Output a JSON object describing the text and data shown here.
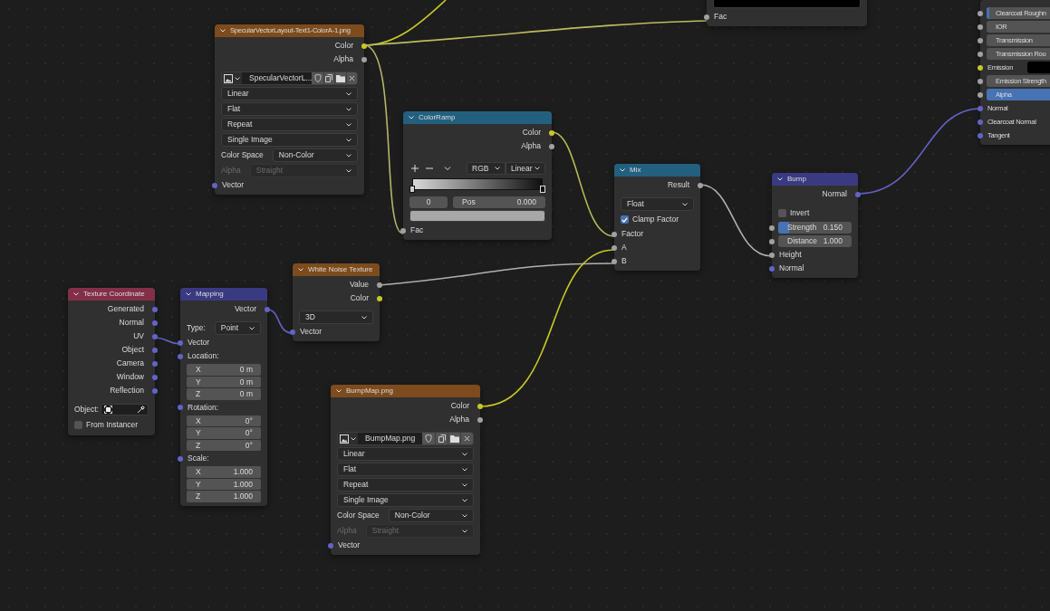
{
  "nodes": [
    {
      "kind": "frame",
      "rows": [
        {
          "kind": "swatch",
          "color": "#000000"
        },
        {
          "kind": "input",
          "label": "Fac",
          "socket": {
            "kind": "float"
          }
        }
      ]
    },
    {
      "kind": "shader",
      "rows": [
        {
          "kind": "slider",
          "label": "Clearcoat Roughn",
          "socket": {
            "kind": "float"
          },
          "level": 0.04
        },
        {
          "kind": "number",
          "label": "IOR",
          "socket": {
            "kind": "float"
          }
        },
        {
          "kind": "number",
          "label": "Transmission",
          "socket": {
            "kind": "float"
          }
        },
        {
          "kind": "number",
          "label": "Transmission Rou",
          "socket": {
            "kind": "float"
          }
        },
        {
          "kind": "color_input",
          "label": "Emission",
          "socket": {
            "kind": "color"
          },
          "color": "#000000"
        },
        {
          "kind": "number",
          "label": "Emission Strength",
          "socket": {
            "kind": "float"
          }
        },
        {
          "kind": "slider",
          "label": "Alpha",
          "socket": {
            "kind": "float"
          },
          "level": 1
        },
        {
          "kind": "input",
          "label": "Normal",
          "socket": {
            "kind": "vector"
          }
        },
        {
          "kind": "input",
          "label": "Clearcoat Normal",
          "socket": {
            "kind": "vector"
          }
        },
        {
          "kind": "input",
          "label": "Tangent",
          "socket": {
            "kind": "vector"
          }
        }
      ]
    },
    {
      "kind": "texture",
      "title": "SpecularVectorLayout-Text1-ColorA-1.png",
      "rows": [
        {
          "kind": "output",
          "label": "Color",
          "socket": {
            "kind": "color"
          }
        },
        {
          "kind": "output",
          "label": "Alpha",
          "socket": {
            "kind": "float"
          }
        },
        {
          "kind": "image",
          "value": "SpecularVectorL..."
        },
        {
          "kind": "select",
          "value": "Linear",
          "disabled": false
        },
        {
          "kind": "select",
          "value": "Flat",
          "disabled": false
        },
        {
          "kind": "select",
          "value": "Repeat",
          "disabled": false
        },
        {
          "kind": "select",
          "value": "Single Image",
          "disabled": false
        },
        {
          "kind": "select",
          "label": "Color Space",
          "value": "Non-Color",
          "disabled": false
        },
        {
          "kind": "select",
          "label": "Alpha",
          "value": "Straight",
          "disabled": true
        },
        {
          "kind": "input",
          "label": "Vector",
          "socket": {
            "kind": "vector"
          }
        }
      ]
    },
    {
      "kind": "converter",
      "title": "ColorRamp",
      "rows": [
        {
          "kind": "output",
          "label": "Color",
          "socket": {
            "kind": "color"
          }
        },
        {
          "kind": "output",
          "label": "Alpha",
          "socket": {
            "kind": "float"
          }
        },
        {
          "kind": "ramp",
          "color_mode": "RGB",
          "interpolation": "Linear",
          "index": "0",
          "pos_label": "Pos",
          "pos_value": "0.000"
        },
        {
          "kind": "swatch",
          "color": "#a8a8a8"
        },
        {
          "kind": "input",
          "label": "Fac",
          "socket": {
            "kind": "float"
          }
        }
      ]
    },
    {
      "kind": "converter",
      "title": "Mix",
      "rows": [
        {
          "kind": "output",
          "label": "Result",
          "socket": {
            "kind": "float"
          }
        },
        {
          "kind": "select",
          "value": "Float",
          "disabled": false
        },
        {
          "kind": "checkbox",
          "label": "Clamp Factor",
          "checked": true
        },
        {
          "kind": "input",
          "label": "Factor",
          "socket": {
            "kind": "float"
          }
        },
        {
          "kind": "input",
          "label": "A",
          "socket": {
            "kind": "float"
          }
        },
        {
          "kind": "input",
          "label": "B",
          "socket": {
            "kind": "float"
          }
        }
      ]
    },
    {
      "kind": "vector",
      "title": "Bump",
      "rows": [
        {
          "kind": "output",
          "label": "Normal",
          "socket": {
            "kind": "vector"
          }
        },
        {
          "kind": "checkbox",
          "label": "Invert",
          "checked": false
        },
        {
          "kind": "slider",
          "label": "Strength",
          "value": "0.150",
          "socket": {
            "kind": "float"
          },
          "level": 0.15
        },
        {
          "kind": "number",
          "label": "Distance",
          "value": "1.000",
          "socket": {
            "kind": "float"
          }
        },
        {
          "kind": "input",
          "label": "Height",
          "socket": {
            "kind": "float"
          }
        },
        {
          "kind": "input",
          "label": "Normal",
          "socket": {
            "kind": "vector"
          }
        }
      ]
    },
    {
      "kind": "texture",
      "title": "White Noise Texture",
      "rows": [
        {
          "kind": "output",
          "label": "Value",
          "socket": {
            "kind": "float"
          }
        },
        {
          "kind": "output",
          "label": "Color",
          "socket": {
            "kind": "color"
          }
        },
        {
          "kind": "select",
          "value": "3D",
          "disabled": false
        },
        {
          "kind": "input",
          "label": "Vector",
          "socket": {
            "kind": "vector"
          }
        }
      ]
    },
    {
      "kind": "input",
      "title": "Texture Coordinate",
      "rows": [
        {
          "kind": "output",
          "label": "Generated",
          "socket": {
            "kind": "vector"
          }
        },
        {
          "kind": "output",
          "label": "Normal",
          "socket": {
            "kind": "vector"
          }
        },
        {
          "kind": "output",
          "label": "UV",
          "socket": {
            "kind": "vector"
          }
        },
        {
          "kind": "output",
          "label": "Object",
          "socket": {
            "kind": "vector"
          }
        },
        {
          "kind": "output",
          "label": "Camera",
          "socket": {
            "kind": "vector"
          }
        },
        {
          "kind": "output",
          "label": "Window",
          "socket": {
            "kind": "vector"
          }
        },
        {
          "kind": "output",
          "label": "Reflection",
          "socket": {
            "kind": "vector"
          }
        },
        {
          "kind": "object",
          "label": "Object:"
        },
        {
          "kind": "checkbox",
          "label": "From Instancer",
          "checked": false
        }
      ]
    },
    {
      "kind": "vector",
      "title": "Mapping",
      "rows": [
        {
          "kind": "output",
          "label": "Vector",
          "socket": {
            "kind": "vector"
          }
        },
        {
          "kind": "select",
          "label": "Type:",
          "value": "Point",
          "disabled": false
        },
        {
          "kind": "input",
          "label": "Vector",
          "socket": {
            "kind": "vector"
          }
        },
        {
          "kind": "input",
          "label": "Location:",
          "socket": {
            "kind": "vector"
          }
        },
        {
          "kind": "vector_fields",
          "fields": [
            {
              "axis": "X",
              "value": "0 m"
            },
            {
              "axis": "Y",
              "value": "0 m"
            },
            {
              "axis": "Z",
              "value": "0 m"
            }
          ]
        },
        {
          "kind": "input",
          "label": "Rotation:",
          "socket": {
            "kind": "vector"
          }
        },
        {
          "kind": "vector_fields",
          "fields": [
            {
              "axis": "X",
              "value": "0°"
            },
            {
              "axis": "Y",
              "value": "0°"
            },
            {
              "axis": "Z",
              "value": "0°"
            }
          ]
        },
        {
          "kind": "input",
          "label": "Scale:",
          "socket": {
            "kind": "vector"
          }
        },
        {
          "kind": "vector_fields",
          "fields": [
            {
              "axis": "X",
              "value": "1.000"
            },
            {
              "axis": "Y",
              "value": "1.000"
            },
            {
              "axis": "Z",
              "value": "1.000"
            }
          ]
        }
      ]
    },
    {
      "kind": "texture",
      "title": "BumpMap.png",
      "rows": [
        {
          "kind": "output",
          "label": "Color",
          "socket": {
            "kind": "color"
          }
        },
        {
          "kind": "output",
          "label": "Alpha",
          "socket": {
            "kind": "float"
          }
        },
        {
          "kind": "image",
          "value": "BumpMap.png"
        },
        {
          "kind": "select",
          "value": "Linear",
          "disabled": false
        },
        {
          "kind": "select",
          "value": "Flat",
          "disabled": false
        },
        {
          "kind": "select",
          "value": "Repeat",
          "disabled": false
        },
        {
          "kind": "select",
          "value": "Single Image",
          "disabled": false
        },
        {
          "kind": "select",
          "label": "Color Space",
          "value": "Non-Color",
          "disabled": false
        },
        {
          "kind": "select",
          "label": "Alpha",
          "value": "Straight",
          "disabled": true
        },
        {
          "kind": "input",
          "label": "Vector",
          "socket": {
            "kind": "vector"
          }
        }
      ]
    }
  ]
}
